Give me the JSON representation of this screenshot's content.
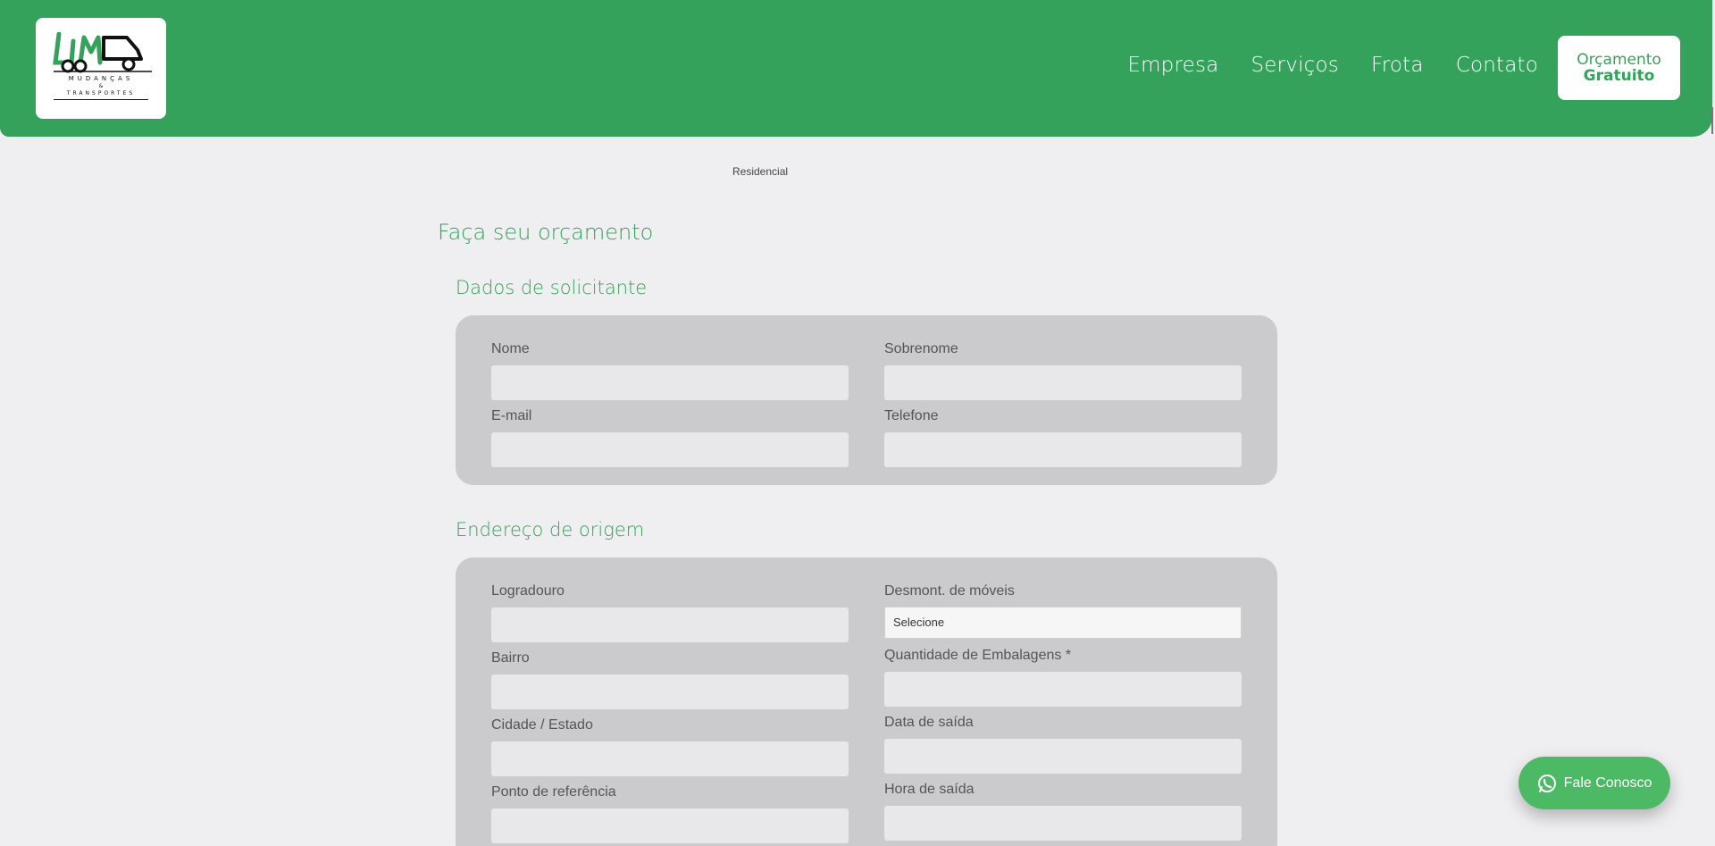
{
  "header": {
    "logo": {
      "line1": "MUDANÇAS",
      "line2": "&",
      "line3": "TRANSPORTES"
    },
    "nav": [
      "Empresa",
      "Serviços",
      "Frota",
      "Contato"
    ],
    "cta": {
      "line1": "Orçamento",
      "line2": "Gratuito"
    },
    "colors": {
      "brand": "#34a25a",
      "background": "#efeef0",
      "panel": "#cbcacc"
    }
  },
  "top_label": "Residencial",
  "form": {
    "title": "Faça seu orçamento",
    "requester": {
      "title": "Dados de solicitante",
      "nome_label": "Nome",
      "sobrenome_label": "Sobrenome",
      "email_label": "E-mail",
      "telefone_label": "Telefone"
    },
    "origin": {
      "title": "Endereço de origem",
      "logradouro_label": "Logradouro",
      "bairro_label": "Bairro",
      "cidade_label": "Cidade / Estado",
      "referencia_label": "Ponto de referência",
      "desmont_label": "Desmont. de móveis",
      "desmont_value": "Selecione",
      "embalagens_label": "Quantidade de Embalagens *",
      "data_label": "Data de saída",
      "hora_label": "Hora de saída"
    }
  },
  "whatsapp": {
    "label": "Fale Conosco",
    "icon": "whatsapp-icon"
  }
}
